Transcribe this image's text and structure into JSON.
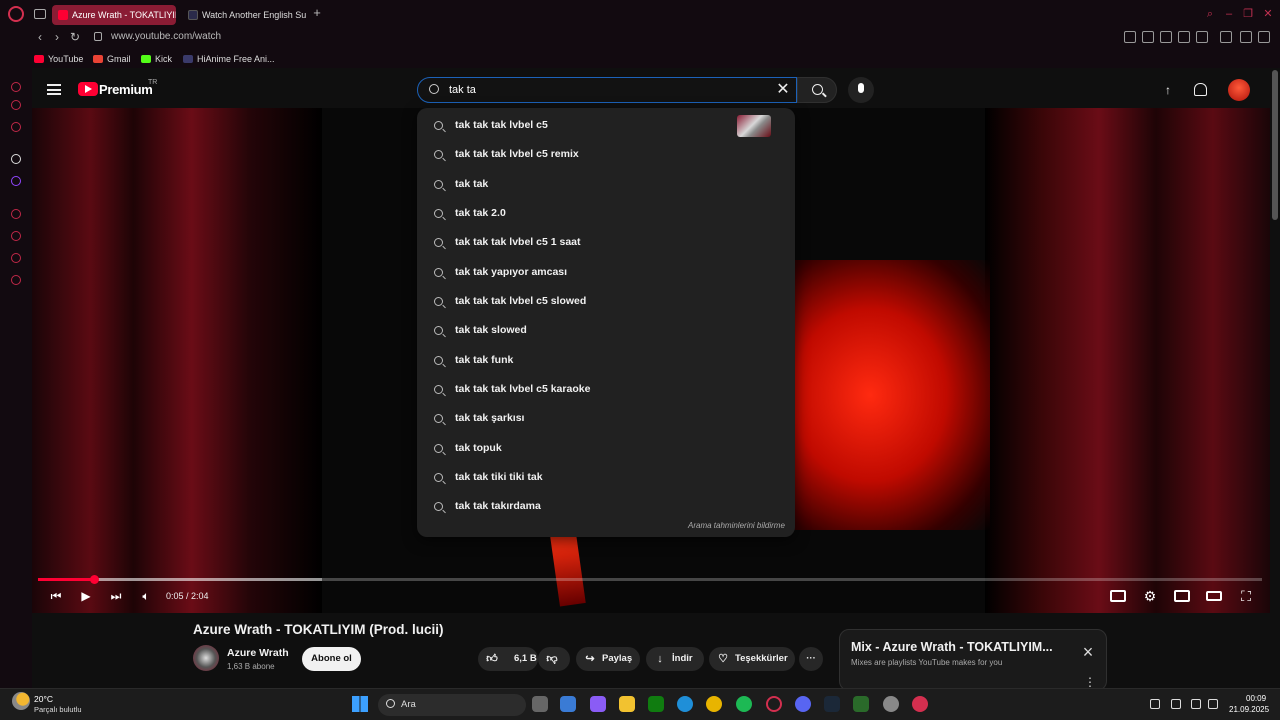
{
  "browser": {
    "tabs": [
      {
        "label": "Azure Wrath - TOKATLIYII",
        "active": true
      },
      {
        "label": "Watch Another English Su",
        "active": false
      }
    ],
    "new_tab": "+",
    "url": "www.youtube.com/watch",
    "bookmarks": [
      "YouTube",
      "Gmail",
      "Kick",
      "HiAnime Free Ani..."
    ],
    "accent": "#d32f4f"
  },
  "youtube": {
    "brand": "Premium",
    "region": "TR",
    "search": {
      "query": "tak ta",
      "suggestions": [
        "tak tak tak lvbel c5",
        "tak tak tak lvbel c5 remix",
        "tak tak",
        "tak tak 2.0",
        "tak tak tak lvbel c5 1 saat",
        "tak tak yapıyor amcası",
        "tak tak tak lvbel c5 slowed",
        "tak tak slowed",
        "tak tak funk",
        "tak tak tak lvbel c5 karaoke",
        "tak tak şarkısı",
        "tak topuk",
        "tak tak tiki tiki tak",
        "tak tak takırdama"
      ],
      "report": "Arama tahminlerini bildirme"
    },
    "player": {
      "time": "0:05 / 2:04",
      "progress_fraction": 0.046,
      "buffered_fraction": 0.232
    },
    "video": {
      "title": "Azure Wrath - TOKATLIYIM (Prod. lucii)",
      "channel": "Azure Wrath",
      "subscribers": "1,63 B abone",
      "subscribe": "Abone ol",
      "likes": "6,1 B",
      "share": "Paylaş",
      "download": "İndir",
      "thanks": "Teşekkürler",
      "more": "···"
    },
    "mix": {
      "title": "Mix - Azure Wrath - TOKATLIYIM...",
      "subtitle": "Mixes are playlists YouTube makes for you"
    }
  },
  "taskbar": {
    "temperature": "20°C",
    "condition": "Parçalı bulutlu",
    "search": "Ara",
    "time": "00:09",
    "date": "21.09.2025"
  }
}
